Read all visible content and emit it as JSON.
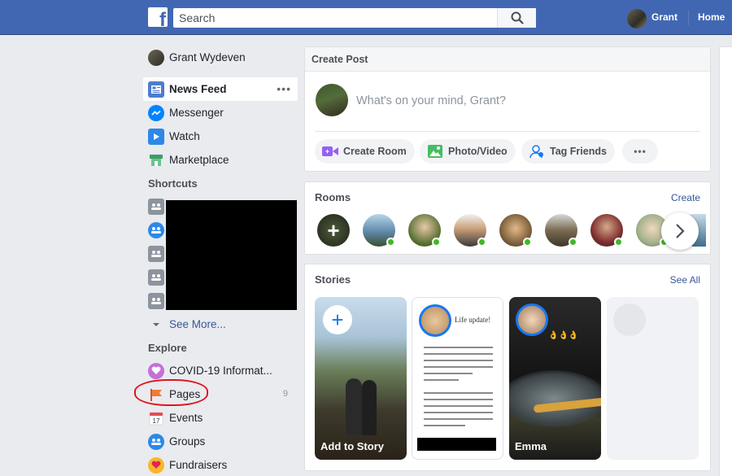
{
  "topbar": {
    "logo": "f",
    "search_placeholder": "Search",
    "user_name": "Grant",
    "home_label": "Home"
  },
  "leftnav": {
    "profile_name": "Grant Wydeven",
    "items": [
      {
        "label": "News Feed",
        "icon": "news-feed-icon"
      },
      {
        "label": "Messenger",
        "icon": "messenger-icon"
      },
      {
        "label": "Watch",
        "icon": "watch-icon"
      },
      {
        "label": "Marketplace",
        "icon": "marketplace-icon"
      }
    ],
    "shortcuts_title": "Shortcuts",
    "see_more": "See More...",
    "explore_title": "Explore",
    "explore_items": [
      {
        "label": "COVID-19 Informat...",
        "icon": "covid-heart-icon"
      },
      {
        "label": "Pages",
        "icon": "pages-flag-icon",
        "count": "9"
      },
      {
        "label": "Events",
        "icon": "events-calendar-icon"
      },
      {
        "label": "Groups",
        "icon": "groups-icon"
      },
      {
        "label": "Fundraisers",
        "icon": "fundraisers-icon"
      }
    ]
  },
  "create_post": {
    "title": "Create Post",
    "prompt": "What's on your mind, Grant?",
    "actions": [
      "Create Room",
      "Photo/Video",
      "Tag Friends"
    ]
  },
  "rooms": {
    "title": "Rooms",
    "create_label": "Create"
  },
  "stories": {
    "title": "Stories",
    "see_all": "See All",
    "add_story": "Add to Story",
    "story_name": "Emma",
    "story2_caption": "Life update!"
  },
  "colors": {
    "brand_blue": "#4267b2",
    "link_blue": "#385898",
    "online_green": "#42b72a",
    "annotation_red": "#e0141e"
  }
}
